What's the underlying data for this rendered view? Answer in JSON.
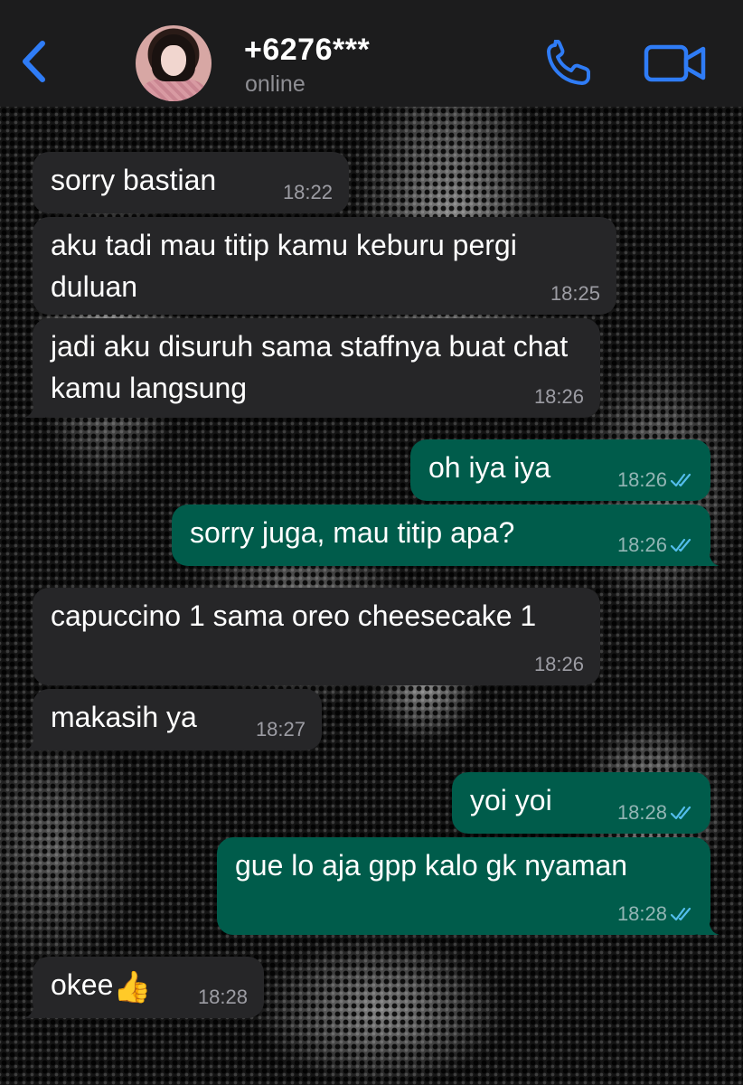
{
  "header": {
    "back_icon": "chevron-left-icon",
    "contact_name": "+6276***",
    "status": "online",
    "call_icon": "phone-icon",
    "video_icon": "video-camera-icon",
    "accent_color": "#2f7cf6"
  },
  "colors": {
    "incoming_bubble": "#262628",
    "outgoing_bubble": "#005c4b",
    "read_tick": "#53bdeb"
  },
  "messages": [
    {
      "direction": "in",
      "text": "sorry bastian",
      "time": "18:22"
    },
    {
      "direction": "in",
      "text": "aku tadi mau titip kamu keburu pergi duluan",
      "time": "18:25"
    },
    {
      "direction": "in",
      "text": "jadi aku disuruh sama staffnya buat chat kamu langsung",
      "time": "18:26"
    },
    {
      "direction": "out",
      "text": "oh iya iya",
      "time": "18:26",
      "status": "read"
    },
    {
      "direction": "out",
      "text": "sorry juga, mau titip apa?",
      "time": "18:26",
      "status": "read"
    },
    {
      "direction": "in",
      "text": "capuccino 1 sama oreo cheesecake 1",
      "time": "18:26"
    },
    {
      "direction": "in",
      "text": "makasih ya",
      "time": "18:27"
    },
    {
      "direction": "out",
      "text": "yoi yoi",
      "time": "18:28",
      "status": "read"
    },
    {
      "direction": "out",
      "text": "gue lo aja gpp kalo gk nyaman",
      "time": "18:28",
      "status": "read"
    },
    {
      "direction": "in",
      "text": "okee",
      "emoji": "👍",
      "time": "18:28"
    }
  ]
}
